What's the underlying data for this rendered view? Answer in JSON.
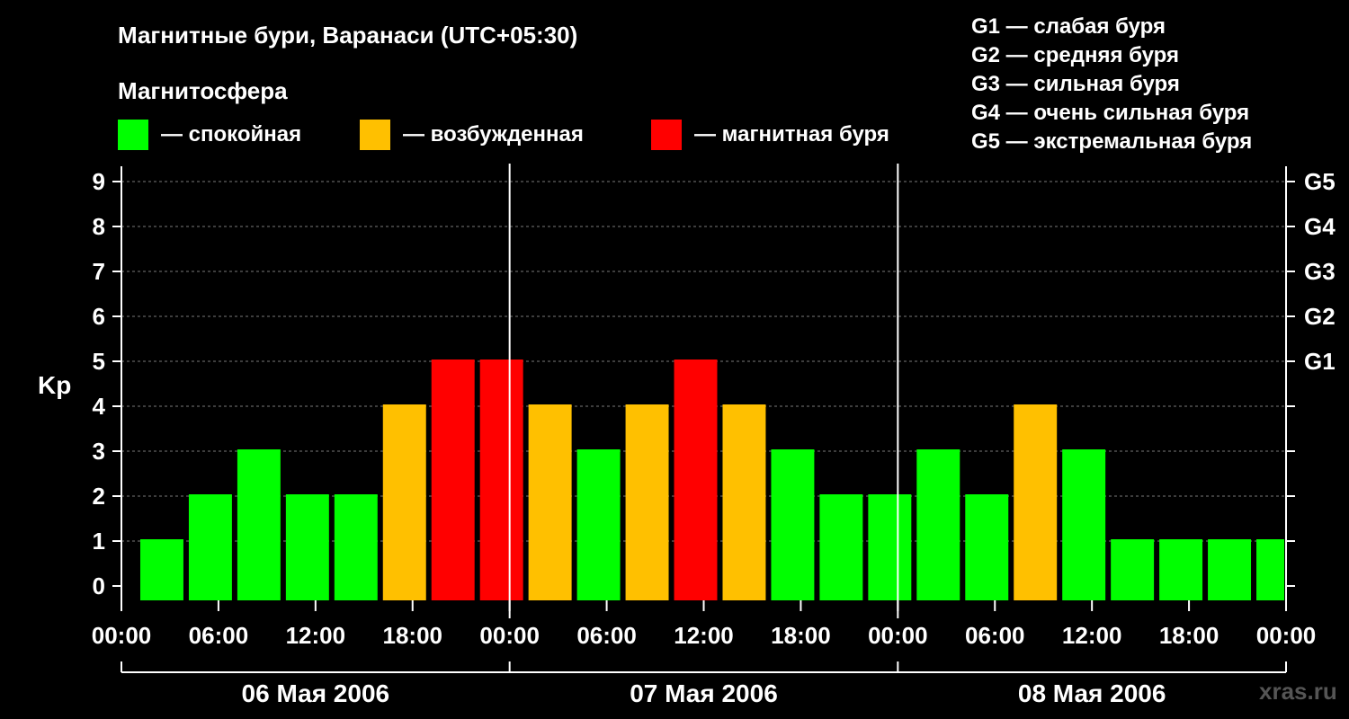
{
  "header": {
    "title": "Магнитные бури, Варанаси (UTC+05:30)",
    "subtitle": "Магнитосфера"
  },
  "legend": {
    "items": [
      {
        "label": "— спокойная",
        "color": "#00ff00"
      },
      {
        "label": "— возбужденная",
        "color": "#ffc000"
      },
      {
        "label": "— магнитная буря",
        "color": "#ff0000"
      }
    ]
  },
  "g_legend": [
    "G1 — слабая буря",
    "G2 — средняя буря",
    "G3 — сильная буря",
    "G4 — очень сильная буря",
    "G5 — экстремальная буря"
  ],
  "watermark": "xras.ru",
  "chart_data": {
    "type": "bar",
    "ylabel": "Kp",
    "ylim": [
      0,
      9
    ],
    "y_ticks": [
      0,
      1,
      2,
      3,
      4,
      5,
      6,
      7,
      8,
      9
    ],
    "y2_ticks": [
      {
        "value": 5,
        "label": "G1"
      },
      {
        "value": 6,
        "label": "G2"
      },
      {
        "value": 7,
        "label": "G3"
      },
      {
        "value": 8,
        "label": "G4"
      },
      {
        "value": 9,
        "label": "G5"
      }
    ],
    "x_tick_labels": [
      "00:00",
      "06:00",
      "12:00",
      "18:00",
      "00:00",
      "06:00",
      "12:00",
      "18:00",
      "00:00",
      "06:00",
      "12:00",
      "18:00",
      "00:00"
    ],
    "days": [
      "06 Мая 2006",
      "07 Мая 2006",
      "08 Мая 2006"
    ],
    "x_range_hours": [
      0,
      72
    ],
    "bar_start_hour": 2.5,
    "bar_interval_hours": 3,
    "values": [
      1,
      2,
      3,
      2,
      2,
      4,
      5,
      5,
      4,
      3,
      4,
      5,
      4,
      3,
      2,
      2,
      3,
      2,
      4,
      3,
      1,
      1,
      1,
      1
    ],
    "status": [
      "quiet",
      "quiet",
      "quiet",
      "quiet",
      "quiet",
      "active",
      "storm",
      "storm",
      "active",
      "quiet",
      "active",
      "storm",
      "active",
      "quiet",
      "quiet",
      "quiet",
      "quiet",
      "quiet",
      "active",
      "quiet",
      "quiet",
      "quiet",
      "quiet",
      "quiet"
    ],
    "colors": {
      "quiet": "#00ff00",
      "active": "#ffc000",
      "storm": "#ff0000"
    },
    "grid": true
  }
}
